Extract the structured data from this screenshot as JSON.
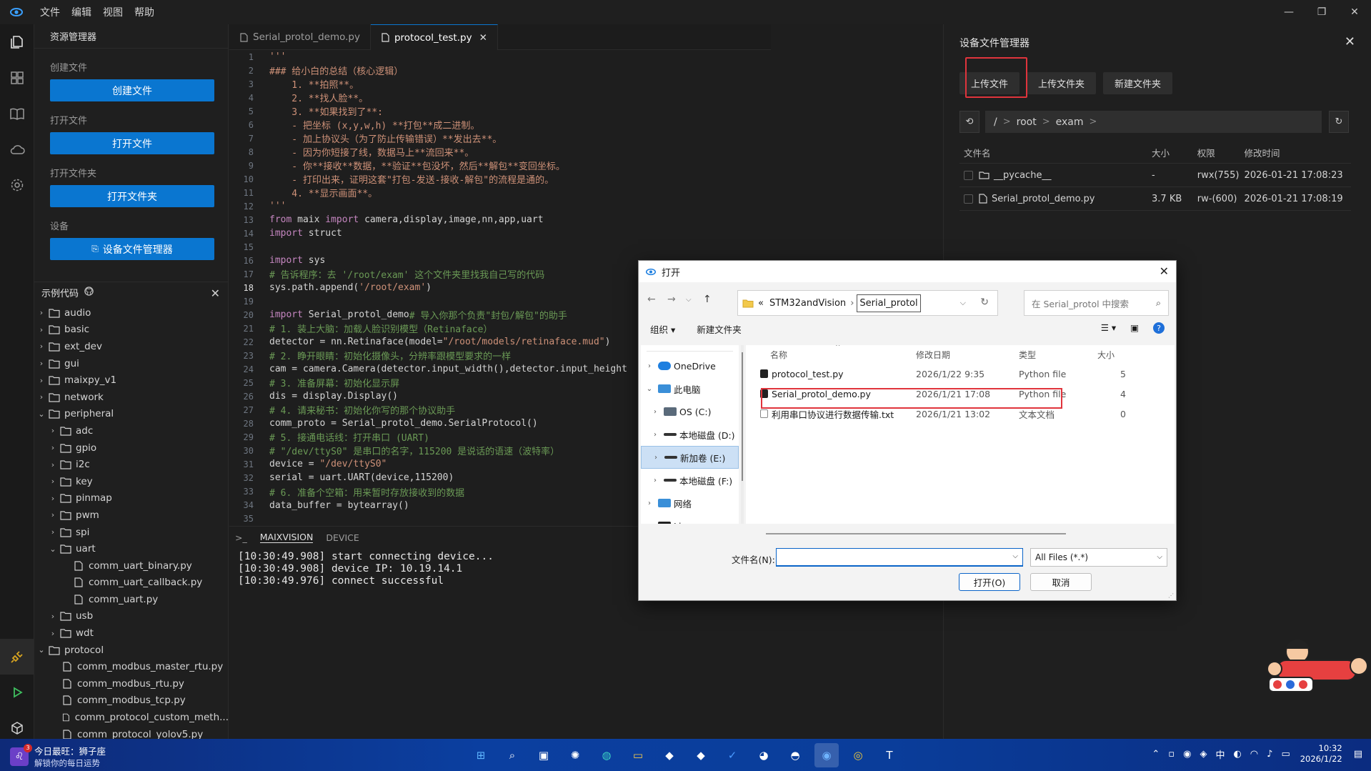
{
  "menubar": {
    "items": [
      "文件",
      "编辑",
      "视图",
      "帮助"
    ],
    "window_controls": [
      "—",
      "❐",
      "✕"
    ]
  },
  "sidebar": {
    "title": "资源管理器",
    "create_label": "创建文件",
    "create_button": "创建文件",
    "open_label": "打开文件",
    "open_button": "打开文件",
    "folder_label": "打开文件夹",
    "folder_button": "打开文件夹",
    "device_label": "设备",
    "device_button": "设备文件管理器",
    "examples_title": "示例代码",
    "tree": [
      {
        "label": "audio",
        "type": "folder",
        "level": 0,
        "open": false
      },
      {
        "label": "basic",
        "type": "folder",
        "level": 0,
        "open": false
      },
      {
        "label": "ext_dev",
        "type": "folder",
        "level": 0,
        "open": false
      },
      {
        "label": "gui",
        "type": "folder",
        "level": 0,
        "open": false
      },
      {
        "label": "maixpy_v1",
        "type": "folder",
        "level": 0,
        "open": false
      },
      {
        "label": "network",
        "type": "folder",
        "level": 0,
        "open": false
      },
      {
        "label": "peripheral",
        "type": "folder",
        "level": 0,
        "open": true
      },
      {
        "label": "adc",
        "type": "folder",
        "level": 1,
        "open": false
      },
      {
        "label": "gpio",
        "type": "folder",
        "level": 1,
        "open": false
      },
      {
        "label": "i2c",
        "type": "folder",
        "level": 1,
        "open": false
      },
      {
        "label": "key",
        "type": "folder",
        "level": 1,
        "open": false
      },
      {
        "label": "pinmap",
        "type": "folder",
        "level": 1,
        "open": false
      },
      {
        "label": "pwm",
        "type": "folder",
        "level": 1,
        "open": false
      },
      {
        "label": "spi",
        "type": "folder",
        "level": 1,
        "open": false
      },
      {
        "label": "uart",
        "type": "folder",
        "level": 1,
        "open": true
      },
      {
        "label": "comm_uart_binary.py",
        "type": "file",
        "level": 2
      },
      {
        "label": "comm_uart_callback.py",
        "type": "file",
        "level": 2
      },
      {
        "label": "comm_uart.py",
        "type": "file",
        "level": 2
      },
      {
        "label": "usb",
        "type": "folder",
        "level": 1,
        "open": false
      },
      {
        "label": "wdt",
        "type": "folder",
        "level": 1,
        "open": false
      },
      {
        "label": "protocol",
        "type": "folder",
        "level": 0,
        "open": true
      },
      {
        "label": "comm_modbus_master_rtu.py",
        "type": "file",
        "level": 1
      },
      {
        "label": "comm_modbus_rtu.py",
        "type": "file",
        "level": 1
      },
      {
        "label": "comm_modbus_tcp.py",
        "type": "file",
        "level": 1
      },
      {
        "label": "comm_protocol_custom_meth...",
        "type": "file",
        "level": 1
      },
      {
        "label": "comm_protocol_yolov5.py",
        "type": "file",
        "level": 1
      }
    ]
  },
  "tabs": [
    {
      "label": "Serial_protol_demo.py",
      "active": false
    },
    {
      "label": "protocol_test.py",
      "active": true
    }
  ],
  "editor": {
    "current_line": 18,
    "lines": [
      {
        "n": 1,
        "segs": [
          {
            "t": "'''",
            "c": "str"
          }
        ]
      },
      {
        "n": 2,
        "segs": [
          {
            "t": "### 给小白的总结（核心逻辑）",
            "c": "str"
          }
        ]
      },
      {
        "n": 3,
        "segs": [
          {
            "t": "    1. **拍照**。",
            "c": "str"
          }
        ]
      },
      {
        "n": 4,
        "segs": [
          {
            "t": "    2. **找人脸**。",
            "c": "str"
          }
        ]
      },
      {
        "n": 5,
        "segs": [
          {
            "t": "    3. **如果找到了**:",
            "c": "str"
          }
        ]
      },
      {
        "n": 6,
        "segs": [
          {
            "t": "    - 把坐标 (x,y,w,h) **打包**成二进制。",
            "c": "str"
          }
        ]
      },
      {
        "n": 7,
        "segs": [
          {
            "t": "    - 加上协议头（为了防止传输错误）**发出去**。",
            "c": "str"
          }
        ]
      },
      {
        "n": 8,
        "segs": [
          {
            "t": "    - 因为你短接了线，数据马上**流回来**。",
            "c": "str"
          }
        ]
      },
      {
        "n": 9,
        "segs": [
          {
            "t": "    - 你**接收**数据，**验证**包没坏，然后**解包**变回坐标。",
            "c": "str"
          }
        ]
      },
      {
        "n": 10,
        "segs": [
          {
            "t": "    - 打印出来，证明这套\"打包-发送-接收-解包\"的流程是通的。",
            "c": "str"
          }
        ]
      },
      {
        "n": 11,
        "segs": [
          {
            "t": "    4. **显示画面**。",
            "c": "str"
          }
        ]
      },
      {
        "n": 12,
        "segs": [
          {
            "t": "'''",
            "c": "str"
          }
        ]
      },
      {
        "n": 13,
        "segs": [
          {
            "t": "from",
            "c": "kw"
          },
          {
            "t": " maix ",
            "c": ""
          },
          {
            "t": "import",
            "c": "kw"
          },
          {
            "t": " camera,display,image,nn,app,uart",
            "c": ""
          }
        ]
      },
      {
        "n": 14,
        "segs": [
          {
            "t": "import",
            "c": "kw"
          },
          {
            "t": " struct",
            "c": ""
          }
        ]
      },
      {
        "n": 15,
        "segs": []
      },
      {
        "n": 16,
        "segs": [
          {
            "t": "import",
            "c": "kw"
          },
          {
            "t": " sys",
            "c": ""
          }
        ]
      },
      {
        "n": 17,
        "segs": [
          {
            "t": "# 告诉程序：去 '/root/exam' 这个文件夹里找我自己写的代码",
            "c": "com"
          }
        ]
      },
      {
        "n": 18,
        "segs": [
          {
            "t": "sys.path.append(",
            "c": ""
          },
          {
            "t": "'/root/exam'",
            "c": "str"
          },
          {
            "t": ")",
            "c": ""
          }
        ]
      },
      {
        "n": 19,
        "segs": []
      },
      {
        "n": 20,
        "segs": [
          {
            "t": "import",
            "c": "kw"
          },
          {
            "t": " Serial_protol_demo",
            "c": ""
          },
          {
            "t": "# 导入你那个负责\"封包/解包\"的助手",
            "c": "com"
          }
        ]
      },
      {
        "n": 21,
        "segs": [
          {
            "t": "# 1. 装上大脑：加载人脸识别模型（Retinaface）",
            "c": "com"
          }
        ]
      },
      {
        "n": 22,
        "segs": [
          {
            "t": "detector = nn.Retinaface(model=",
            "c": ""
          },
          {
            "t": "\"/root/models/retinaface.mud\"",
            "c": "str"
          },
          {
            "t": ")",
            "c": ""
          }
        ]
      },
      {
        "n": 23,
        "segs": [
          {
            "t": "# 2. 睁开眼睛：初始化摄像头，分辨率跟模型要求的一样",
            "c": "com"
          }
        ]
      },
      {
        "n": 24,
        "segs": [
          {
            "t": "cam = camera.Camera(detector.input_width(),detector.input_height",
            "c": ""
          }
        ]
      },
      {
        "n": 25,
        "segs": [
          {
            "t": "# 3. 准备屏幕：初始化显示屏",
            "c": "com"
          }
        ]
      },
      {
        "n": 26,
        "segs": [
          {
            "t": "dis = display.Display()",
            "c": ""
          }
        ]
      },
      {
        "n": 27,
        "segs": [
          {
            "t": "# 4. 请来秘书：初始化你写的那个协议助手",
            "c": "com"
          }
        ]
      },
      {
        "n": 28,
        "segs": [
          {
            "t": "comm_proto = Serial_protol_demo.SerialProtocol()",
            "c": ""
          }
        ]
      },
      {
        "n": 29,
        "segs": [
          {
            "t": "# 5. 接通电话线：打开串口 (UART)",
            "c": "com"
          }
        ]
      },
      {
        "n": 30,
        "segs": [
          {
            "t": "# \"/dev/ttyS0\" 是串口的名字，115200 是说话的语速（波特率）",
            "c": "com"
          }
        ]
      },
      {
        "n": 31,
        "segs": [
          {
            "t": "device = ",
            "c": ""
          },
          {
            "t": "\"/dev/ttyS0\"",
            "c": "str"
          }
        ]
      },
      {
        "n": 32,
        "segs": [
          {
            "t": "serial = uart.UART(device,115200)",
            "c": ""
          }
        ]
      },
      {
        "n": 33,
        "segs": [
          {
            "t": "# 6. 准备个空箱：用来暂时存放接收到的数据",
            "c": "com"
          }
        ]
      },
      {
        "n": 34,
        "segs": [
          {
            "t": "data_buffer = bytearray()",
            "c": ""
          }
        ]
      },
      {
        "n": 35,
        "segs": []
      }
    ]
  },
  "terminal": {
    "prompt": ">_",
    "tabs": [
      "MAIXVISION",
      "DEVICE"
    ],
    "lines": [
      "[10:30:49.908] start connecting device...",
      "[10:30:49.908] device IP: 10.19.14.1",
      "[10:30:49.976] connect successful"
    ]
  },
  "device_manager": {
    "title": "设备文件管理器",
    "buttons": [
      "上传文件",
      "上传文件夹",
      "新建文件夹"
    ],
    "path": [
      "/",
      "root",
      "exam"
    ],
    "columns": [
      "文件名",
      "大小",
      "权限",
      "修改时间"
    ],
    "files": [
      {
        "name": "__pycache__",
        "type": "folder",
        "size": "-",
        "perm": "rwx(755)",
        "modified": "2026-01-21 17:08:23"
      },
      {
        "name": "Serial_protol_demo.py",
        "type": "file",
        "size": "3.7 KB",
        "perm": "rw-(600)",
        "modified": "2026-01-21 17:08:19"
      }
    ]
  },
  "dialog": {
    "title": "打开",
    "address": {
      "prefix": "«",
      "parent": "STM32andVision",
      "current": "Serial_protol"
    },
    "search_placeholder": "在 Serial_protol 中搜索",
    "organize": "组织 ▾",
    "new_folder": "新建文件夹",
    "nav_tree": [
      {
        "label": "OneDrive",
        "icon": "cloud-icon",
        "indent": 0,
        "expanded": false,
        "selected": false
      },
      {
        "label": "此电脑",
        "icon": "computer-icon",
        "indent": 0,
        "expanded": true,
        "selected": false
      },
      {
        "label": "OS (C:)",
        "icon": "windows-drive-icon",
        "indent": 1,
        "expanded": false,
        "selected": false
      },
      {
        "label": "本地磁盘 (D:)",
        "icon": "drive-icon",
        "indent": 1,
        "expanded": false,
        "selected": false
      },
      {
        "label": "新加卷 (E:)",
        "icon": "drive-icon",
        "indent": 1,
        "expanded": false,
        "selected": true
      },
      {
        "label": "本地磁盘 (F:)",
        "icon": "drive-icon",
        "indent": 1,
        "expanded": false,
        "selected": false
      },
      {
        "label": "网络",
        "icon": "network-icon",
        "indent": 0,
        "expanded": false,
        "selected": false
      },
      {
        "label": "Linux",
        "icon": "linux-icon",
        "indent": 0,
        "expanded": false,
        "selected": false
      }
    ],
    "columns": [
      "名称",
      "修改日期",
      "类型",
      "大小"
    ],
    "files": [
      {
        "name": "protocol_test.py",
        "date": "2026/1/22 9:35",
        "type": "Python file",
        "size": "5",
        "icon": "python-file-icon"
      },
      {
        "name": "Serial_protol_demo.py",
        "date": "2026/1/21 17:08",
        "type": "Python file",
        "size": "4",
        "icon": "python-file-icon"
      },
      {
        "name": "利用串口协议进行数据传输.txt",
        "date": "2026/1/21 13:02",
        "type": "文本文档",
        "size": "0",
        "icon": "text-file-icon"
      }
    ],
    "filename_label": "文件名(N):",
    "filename_value": "",
    "filetype": "All Files (*.*)",
    "open_button": "打开(O)",
    "cancel_button": "取消"
  },
  "taskbar": {
    "weather_line1": "今日最旺：狮子座",
    "weather_line2": "解锁你的每日运势",
    "badge": "3",
    "apps": [
      "windows-start-icon",
      "search-icon",
      "task-view-icon",
      "chatgpt-icon",
      "edge-icon",
      "file-explorer-icon",
      "app-icon",
      "app-icon",
      "todo-icon",
      "cat-icon",
      "qq-icon",
      "maixvision-icon",
      "chrome-icon",
      "typora-icon"
    ],
    "time": "10:32",
    "date": "2026/1/22"
  },
  "colors": {
    "accent": "#0a76d0",
    "highlight_box": "#e0343c",
    "taskbar": "#0b3fa0"
  }
}
